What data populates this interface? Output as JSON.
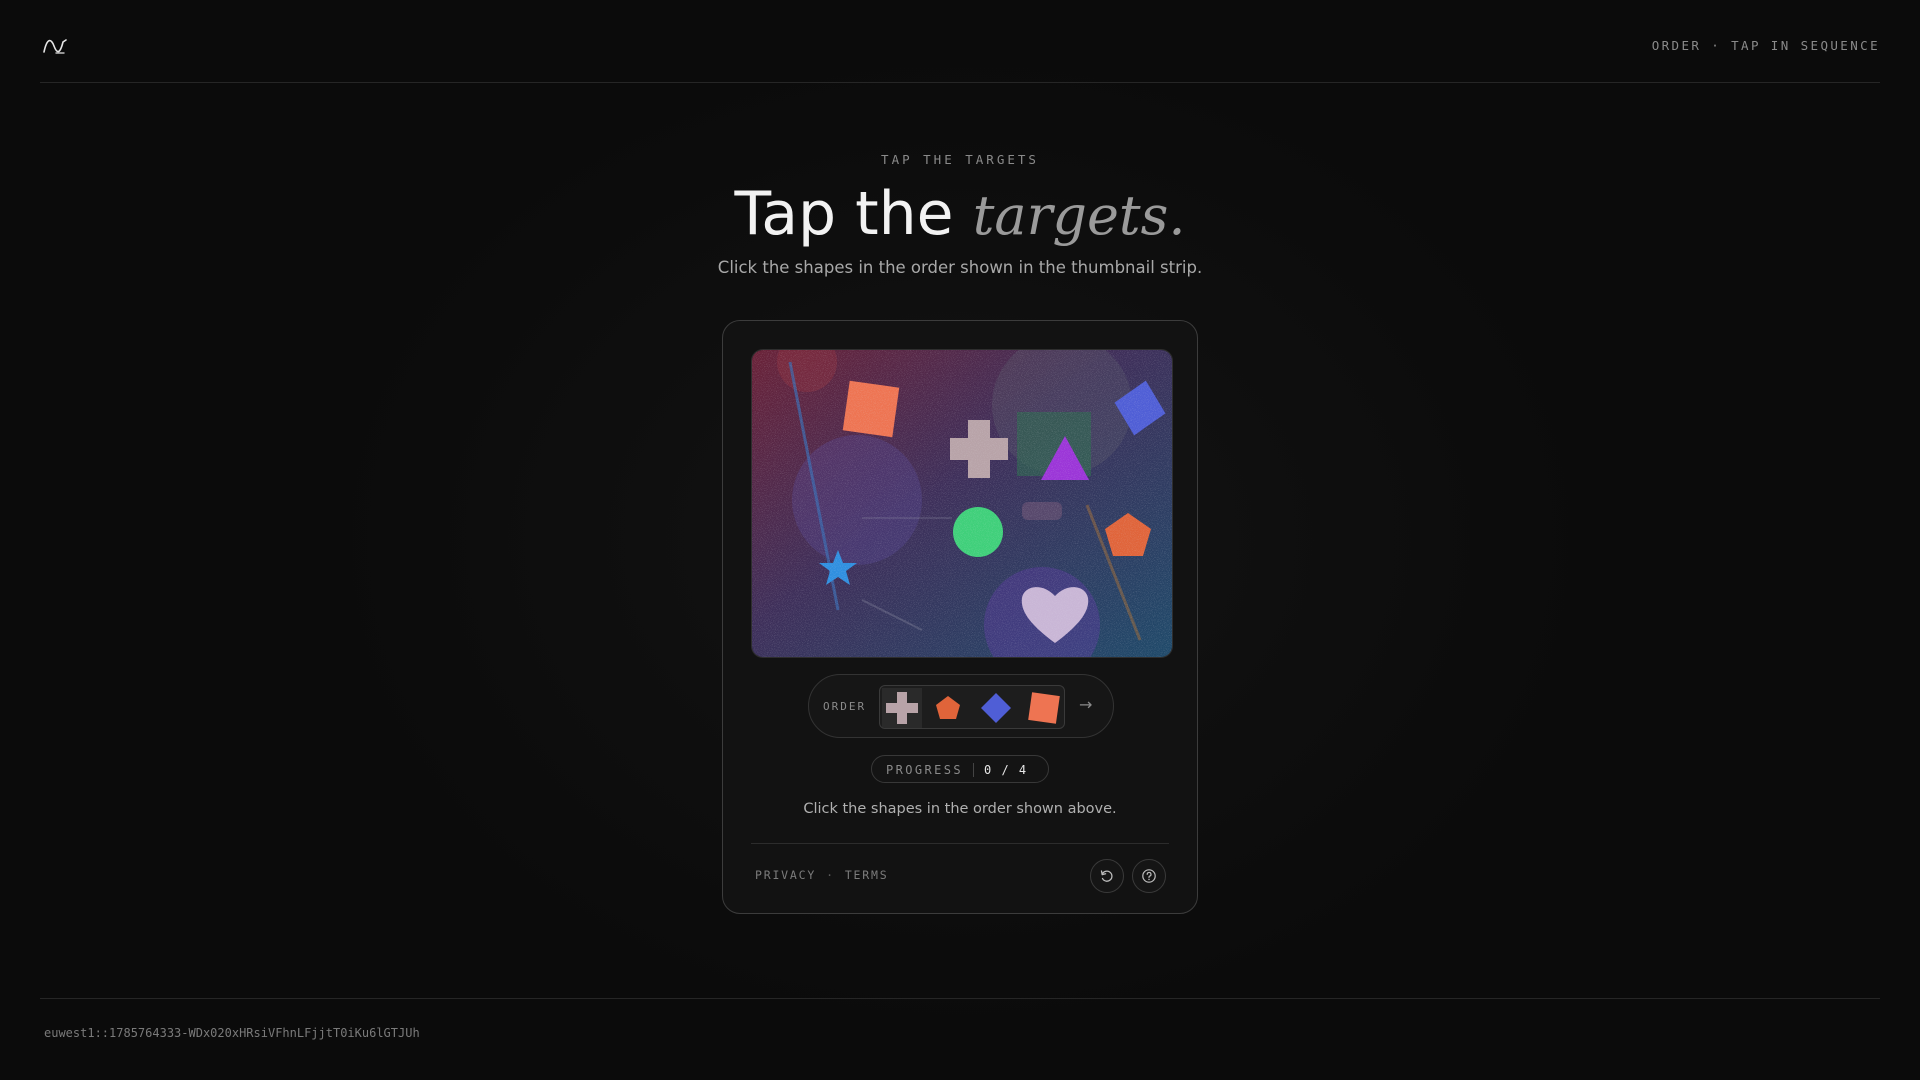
{
  "header": {
    "right_label": "ORDER · TAP IN SEQUENCE"
  },
  "hero": {
    "eyebrow": "TAP THE TARGETS",
    "title_plain": "Tap the",
    "title_emphasis": "targets.",
    "subtitle": "Click the shapes in the order shown in the thumbnail strip."
  },
  "challenge": {
    "order_label": "ORDER",
    "order_sequence": [
      "cross",
      "pentagon",
      "diamond",
      "square"
    ],
    "order_colors": {
      "cross": "#b8a3a8",
      "pentagon": "#e0643a",
      "diamond": "#4f5ed6",
      "square": "#ee7452"
    },
    "progress_label": "PROGRESS",
    "progress_value": "0 / 4",
    "progress_current": 0,
    "progress_total": 4,
    "instruction": "Click the shapes in the order shown above.",
    "canvas_shapes": [
      {
        "shape": "square",
        "color": "#ee7452"
      },
      {
        "shape": "cross",
        "color": "#b8a3a8"
      },
      {
        "shape": "triangle",
        "color": "#9b35d8"
      },
      {
        "shape": "diamond",
        "color": "#4f5ed6"
      },
      {
        "shape": "circle",
        "color": "#3fd07a"
      },
      {
        "shape": "pentagon",
        "color": "#e0643a"
      },
      {
        "shape": "star",
        "color": "#2f8fe0"
      },
      {
        "shape": "heart",
        "color": "#c9b6d6"
      }
    ]
  },
  "footer": {
    "privacy_label": "PRIVACY",
    "terms_label": "TERMS",
    "reload_icon": "reload-icon",
    "help_icon": "help-icon"
  },
  "session_id": "euwest1::1785764333-WDx020xHRsiVFhnLFjjtT0iKu6lGTJUh"
}
